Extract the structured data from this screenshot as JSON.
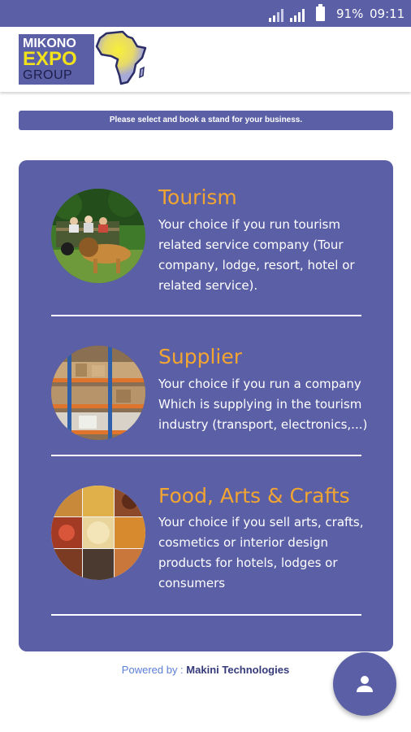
{
  "status_bar": {
    "battery_percent": "91%",
    "time": "09:11",
    "icons": [
      "signal-icon",
      "signal-icon",
      "battery-icon"
    ]
  },
  "header": {
    "logo": {
      "line1": "MIKONO",
      "line2": "EXPO",
      "line3": "GROUP"
    },
    "map_icon": "africa-map-icon"
  },
  "banner": {
    "text": "Please select and book a stand for your business."
  },
  "categories": [
    {
      "title": "Tourism",
      "description": "Your choice if you run tourism related service company (Tour company, lodge, resort, hotel or related service).",
      "image": "safari-lion-photo"
    },
    {
      "title": "Supplier",
      "description": "Your choice if you run a company Which is supplying in the tourism industry (transport, electronics,...)",
      "image": "warehouse-shelves-photo"
    },
    {
      "title": "Food, Arts & Crafts",
      "description": "Your choice if you sell arts, crafts, cosmetics or interior design products for hotels, lodges or consumers",
      "image": "food-collage-photo"
    }
  ],
  "footer": {
    "powered_by": "Powered by : ",
    "company": "Makini Technologies"
  },
  "fab": {
    "icon": "person-icon"
  },
  "colors": {
    "primary": "#5b5fa6",
    "accent_title": "#f3a531",
    "logo_yellow": "#f2e21b"
  }
}
